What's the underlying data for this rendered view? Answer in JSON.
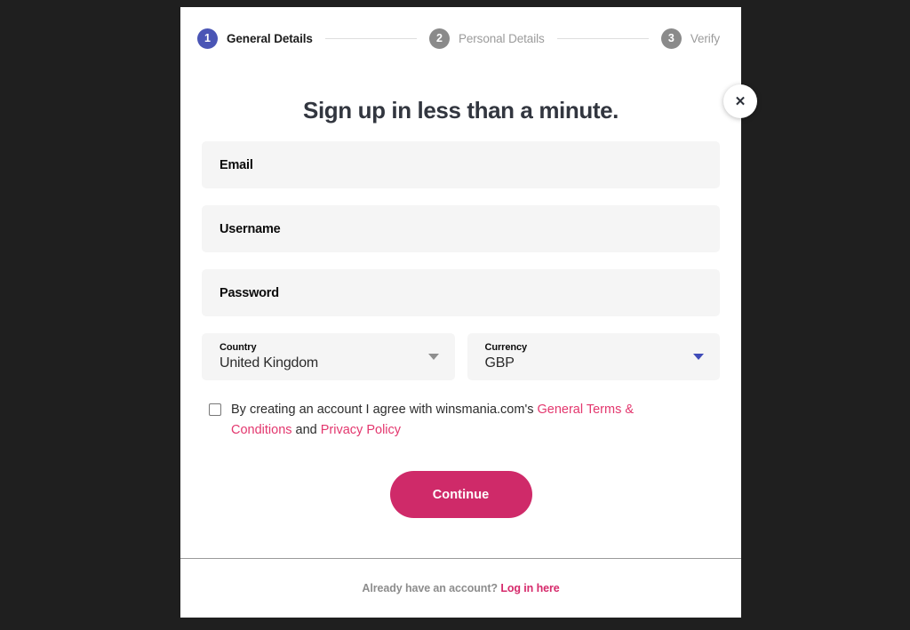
{
  "modal": {
    "title": "Sign up in less than a minute.",
    "close_label": "✕"
  },
  "stepper": {
    "steps": [
      {
        "number": "1",
        "label": "General Details",
        "state": "active"
      },
      {
        "number": "2",
        "label": "Personal Details",
        "state": "inactive"
      },
      {
        "number": "3",
        "label": "Verify",
        "state": "inactive"
      }
    ]
  },
  "form": {
    "fields": [
      {
        "label": "Email",
        "value": ""
      },
      {
        "label": "Username",
        "value": ""
      },
      {
        "label": "Password",
        "value": ""
      }
    ],
    "selects": [
      {
        "label": "Country",
        "value": "United Kingdom",
        "caret": "chevron-down-icon",
        "caret_accent": false
      },
      {
        "label": "Currency",
        "value": "GBP",
        "caret": "chevron-down-icon",
        "caret_accent": true
      }
    ],
    "terms": {
      "checked": false,
      "text_before": "By creating an account I agree with winsmania.com's ",
      "link_terms": "General Terms & Conditions",
      "text_between": " and ",
      "link_privacy": "Privacy Policy"
    },
    "submit_label": "Continue"
  },
  "footer": {
    "prompt": "Already have an account?",
    "link_label": "Log in here"
  },
  "colors": {
    "accent_blue": "#4a55b5",
    "accent_pink": "#cf2a69",
    "link_pink": "#e3376e",
    "field_bg": "#f5f5f5",
    "backdrop": "#1f1f1f"
  }
}
